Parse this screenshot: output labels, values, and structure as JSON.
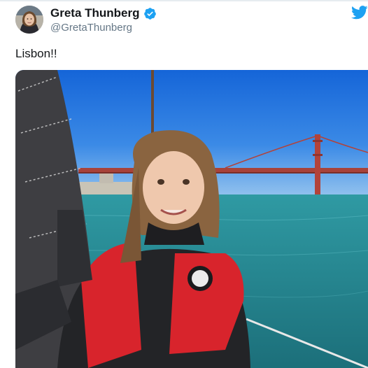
{
  "tweet": {
    "author": {
      "display_name": "Greta Thunberg",
      "handle": "@GretaThunberg",
      "verified": true,
      "avatar_icon": "avatar-photo"
    },
    "text": "Lisbon!!",
    "media": {
      "type": "photo",
      "icon": "photo-girl-on-sailboat-bridge"
    }
  },
  "icons": {
    "verified": "verified-badge-icon",
    "brand": "twitter-bird-icon"
  },
  "colors": {
    "brand_blue": "#1da1f2",
    "name_text": "#14171a",
    "handle_text": "#657786"
  }
}
